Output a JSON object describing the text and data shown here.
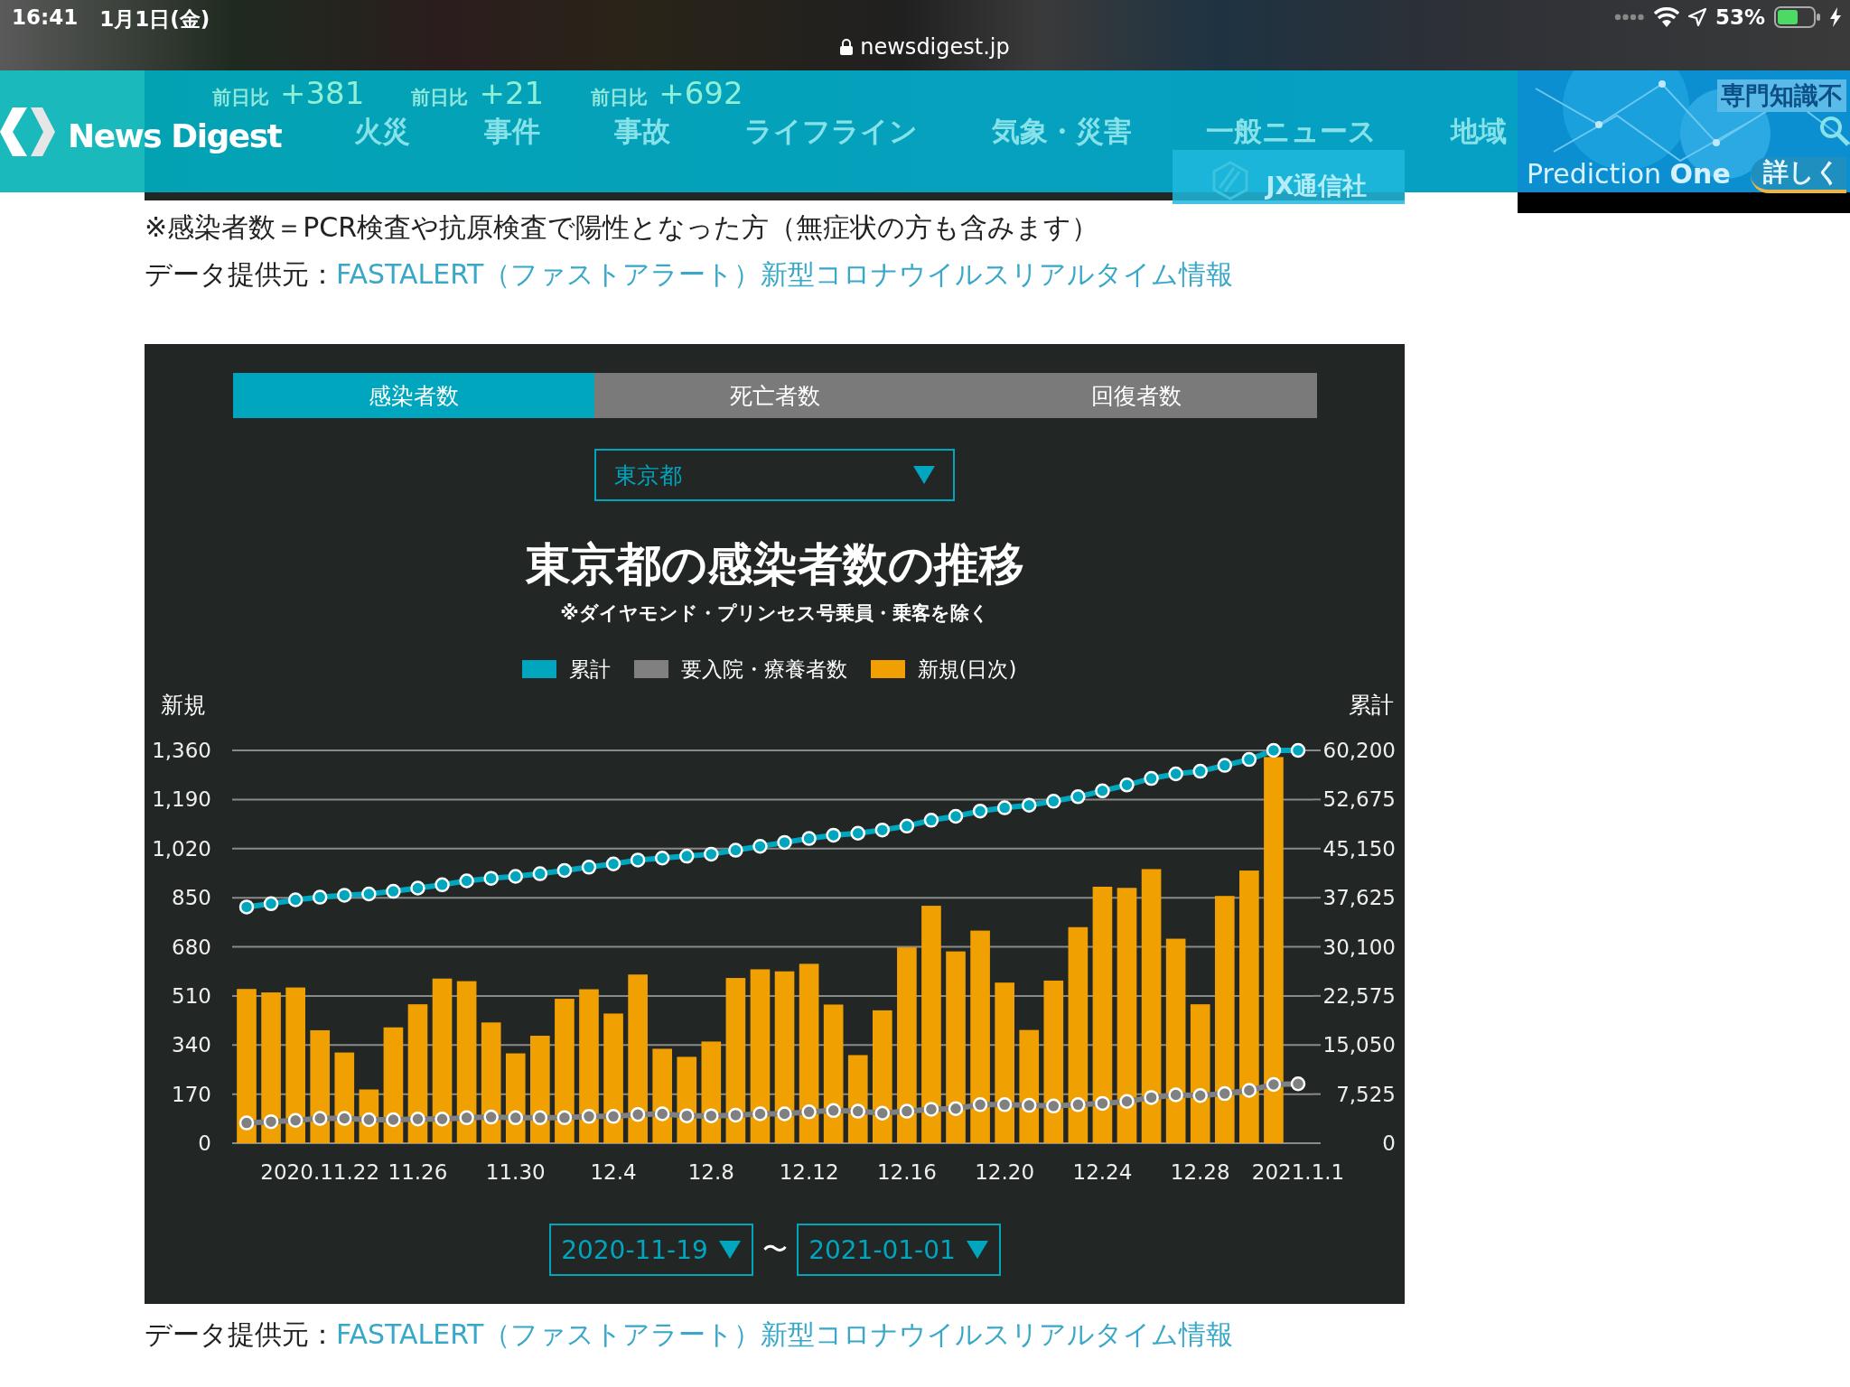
{
  "status_bar": {
    "time": "16:41",
    "date": "1月1日(金)",
    "url": "newsdigest.jp",
    "battery": "53%"
  },
  "header": {
    "logo": "News Digest",
    "nav": [
      {
        "label": "火災"
      },
      {
        "label": "事件"
      },
      {
        "label": "事故"
      },
      {
        "label": "ライフライン"
      },
      {
        "label": "気象・災害"
      },
      {
        "label": "一般ニュース"
      },
      {
        "label": "地域"
      }
    ],
    "underlay_stats": [
      {
        "label": "前日比",
        "value": "+381"
      },
      {
        "label": "前日比",
        "value": "+21"
      },
      {
        "label": "前日比",
        "value": "+692"
      }
    ],
    "badge": "JX通信社"
  },
  "ad": {
    "headline": "専門知識不",
    "product": "Prediction **One**",
    "cta": "詳しく"
  },
  "note": "※感染者数＝PCR検査や抗原検査で陽性となった方（無症状の方も含みます）",
  "source": {
    "label": "データ提供元：",
    "link": "FASTALERT（ファストアラート）新型コロナウイルスリアルタイム情報"
  },
  "panel": {
    "tabs": [
      {
        "label": "感染者数",
        "selected": true
      },
      {
        "label": "死亡者数",
        "selected": false
      },
      {
        "label": "回復者数",
        "selected": false
      }
    ],
    "region": "東京都",
    "title": "東京都の感染者数の推移",
    "subtitle": "※ダイヤモンド・プリンセス号乗員・乗客を除く",
    "chart_data": {
      "type": "bar",
      "ylabel": "新規",
      "y2label": "累計",
      "ylim": [
        0,
        1360
      ],
      "y2lim": [
        0,
        60200
      ],
      "grid": true,
      "categories": [
        null,
        null,
        null,
        "2020.11.22",
        null,
        null,
        null,
        "11.26",
        null,
        null,
        null,
        "11.30",
        null,
        null,
        null,
        "12.4",
        null,
        null,
        null,
        "12.8",
        null,
        null,
        null,
        "12.12",
        null,
        null,
        null,
        "12.16",
        null,
        null,
        null,
        "12.20",
        null,
        null,
        null,
        "12.24",
        null,
        null,
        null,
        "12.28",
        null,
        null,
        null,
        "2021.1.1"
      ],
      "yticks": [
        0,
        170,
        340,
        510,
        680,
        850,
        {
          "value": 1020,
          "label": "1,020"
        },
        {
          "value": 1190,
          "label": "1,190"
        },
        {
          "value": 1360,
          "label": "1,360"
        }
      ],
      "y2ticks": [
        0,
        {
          "value": 7525,
          "label": "7,525"
        },
        {
          "value": 15050,
          "label": "15,050"
        },
        {
          "value": 22575,
          "label": "22,575"
        },
        {
          "value": 30100,
          "label": "30,100"
        },
        {
          "value": 37625,
          "label": "37,625"
        },
        {
          "value": 45150,
          "label": "45,150"
        },
        {
          "value": 52675,
          "label": "52,675"
        },
        {
          "value": 60200,
          "label": "60,200"
        }
      ],
      "series": [
        {
          "name": "累計",
          "color": "#00a6bd",
          "type": "line",
          "marker": "circle",
          "axis": "y2",
          "values": [
            36200,
            36700,
            37300,
            37700,
            38000,
            38200,
            38600,
            39100,
            39600,
            40200,
            40600,
            40900,
            41300,
            41800,
            42300,
            42800,
            43400,
            43700,
            44000,
            44300,
            44900,
            45500,
            46100,
            46700,
            47200,
            47500,
            48000,
            48600,
            49500,
            50100,
            50900,
            51400,
            51800,
            52400,
            53100,
            54000,
            54900,
            55900,
            56600,
            57000,
            57900,
            58800,
            60200,
            60200
          ]
        },
        {
          "name": "要入院・療養者数",
          "color": "#808080",
          "type": "line",
          "marker": "circle",
          "axis": "y2",
          "values": [
            3100,
            3300,
            3500,
            3800,
            3800,
            3600,
            3600,
            3700,
            3700,
            3900,
            4000,
            3900,
            3900,
            3900,
            4100,
            4100,
            4400,
            4500,
            4200,
            4200,
            4300,
            4500,
            4500,
            4800,
            5000,
            4900,
            4600,
            4900,
            5200,
            5300,
            5900,
            5900,
            5800,
            5700,
            5900,
            6100,
            6400,
            7000,
            7400,
            7300,
            7600,
            8100,
            9000,
            9100
          ]
        },
        {
          "name": "新規(日次)",
          "color": "#f0a000",
          "values": [
            534,
            522,
            539,
            391,
            314,
            186,
            401,
            481,
            570,
            561,
            418,
            311,
            372,
            500,
            533,
            449,
            584,
            327,
            299,
            352,
            572,
            602,
            595,
            621,
            480,
            305,
            460,
            678,
            822,
            664,
            736,
            556,
            392,
            563,
            748,
            888,
            884,
            949,
            708,
            481,
            856,
            944,
            1337,
            null
          ]
        }
      ]
    },
    "range": {
      "from": "2020-11-19",
      "separator": "〜",
      "to": "2021-01-01"
    }
  },
  "footer_source": {
    "label": "データ提供元：",
    "link": "FASTALERT（ファストアラート）新型コロナウイルスリアルタイム情報"
  }
}
